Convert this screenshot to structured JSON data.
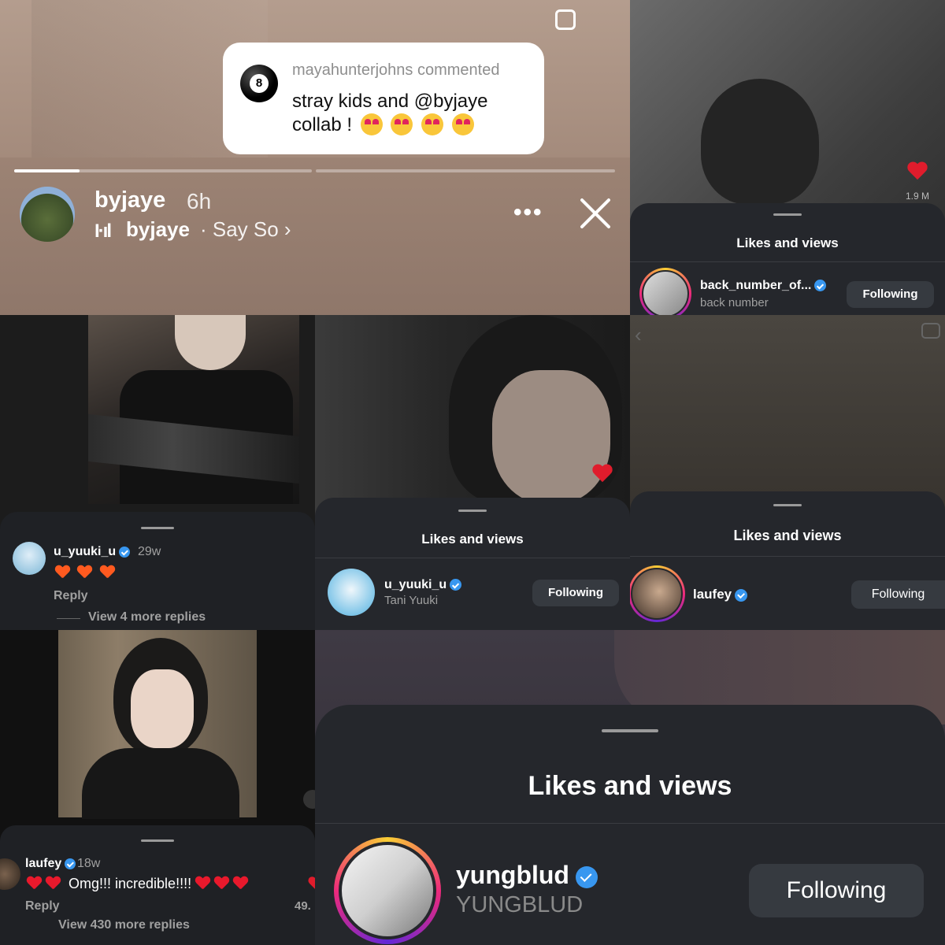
{
  "story": {
    "comment_user": "mayahunterjohns commented",
    "comment_text": "stray kids and @byjaye collab !",
    "ball_number": "8",
    "username": "byjaye",
    "time": "6h",
    "music_artist": "byjaye",
    "music_song": "· Say So ›",
    "progress": [
      0.2,
      0.0
    ]
  },
  "sheet_backnumber": {
    "views": "1.9 M",
    "title": "Likes and views",
    "username": "back_number_of...",
    "fullname": "back number",
    "button": "Following"
  },
  "comment_yuuki": {
    "username": "u_yuuki_u",
    "time": "29w",
    "reply": "Reply",
    "more": "View 4 more replies"
  },
  "sheet_yuuki": {
    "title": "Likes and views",
    "username": "u_yuuki_u",
    "fullname": "Tani Yuuki",
    "button": "Following"
  },
  "sheet_laufey": {
    "title": "Likes and views",
    "username": "laufey",
    "button": "Following"
  },
  "comment_laufey": {
    "username": "laufey",
    "time": "18w",
    "text": "Omg!!! incredible!!!!",
    "reply": "Reply",
    "more": "View 430 more replies",
    "count": "49."
  },
  "sheet_yungblud": {
    "title": "Likes and views",
    "username": "yungblud",
    "fullname": "YUNGBLUD",
    "button": "Following"
  },
  "colors": {
    "verified": "#3897f0",
    "heart": "#e01c2c",
    "sheet": "#25272c"
  }
}
